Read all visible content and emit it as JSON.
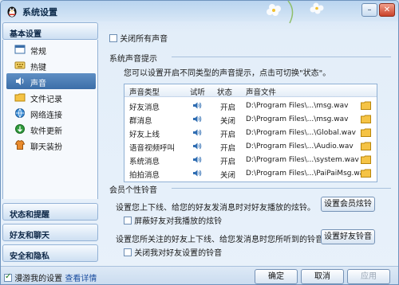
{
  "window": {
    "title": "系统设置"
  },
  "sidebar": {
    "basic_header": "基本设置",
    "items": [
      {
        "label": "常规",
        "icon": "window-icon"
      },
      {
        "label": "热键",
        "icon": "keyboard-icon"
      },
      {
        "label": "声音",
        "icon": "speaker-icon"
      },
      {
        "label": "文件记录",
        "icon": "folder-icon"
      },
      {
        "label": "网络连接",
        "icon": "network-globe-icon"
      },
      {
        "label": "软件更新",
        "icon": "update-icon"
      },
      {
        "label": "聊天装扮",
        "icon": "dressup-icon"
      }
    ],
    "categories": [
      "状态和提醒",
      "好友和聊天",
      "安全和隐私"
    ],
    "roaming_label": "漫游我的设置",
    "detail_link": "查看详情"
  },
  "content": {
    "mute_all": "关闭所有声音",
    "system_sound_title": "系统声音提示",
    "system_sound_desc": "您可以设置开启不同类型的声音提示，点击可切换\"状态\"。",
    "table": {
      "headers": [
        "声音类型",
        "试听",
        "状态",
        "声音文件"
      ],
      "rows": [
        {
          "type": "好友消息",
          "status": "开启",
          "file": "D:\\Program Files\\...\\msg.wav"
        },
        {
          "type": "群消息",
          "status": "关闭",
          "file": "D:\\Program Files\\...\\msg.wav"
        },
        {
          "type": "好友上线",
          "status": "开启",
          "file": "D:\\Program Files\\...\\Global.wav"
        },
        {
          "type": "语音视频呼叫",
          "status": "开启",
          "file": "D:\\Program Files\\...\\Audio.wav"
        },
        {
          "type": "系统消息",
          "status": "开启",
          "file": "D:\\Program Files\\...\\system.wav"
        },
        {
          "type": "拍拍消息",
          "status": "关闭",
          "file": "D:\\Program Files\\...\\PaiPaiMsg.wav"
        }
      ]
    },
    "member_title": "会员个性铃音",
    "member_desc1": "设置您上下线、给您的好友发消息时对好友播放的炫铃。",
    "member_button": "设置会员炫铃",
    "block_friends_ring": "屏蔽好友对我播放的炫铃",
    "member_desc2": "设置您所关注的好友上下线、给您发消息时您所听到的铃音。",
    "friend_ring_button": "设置好友铃音",
    "disable_friend_ring": "关闭我对好友设置的铃音"
  },
  "footer": {
    "ok": "确定",
    "cancel": "取消",
    "apply": "应用"
  }
}
